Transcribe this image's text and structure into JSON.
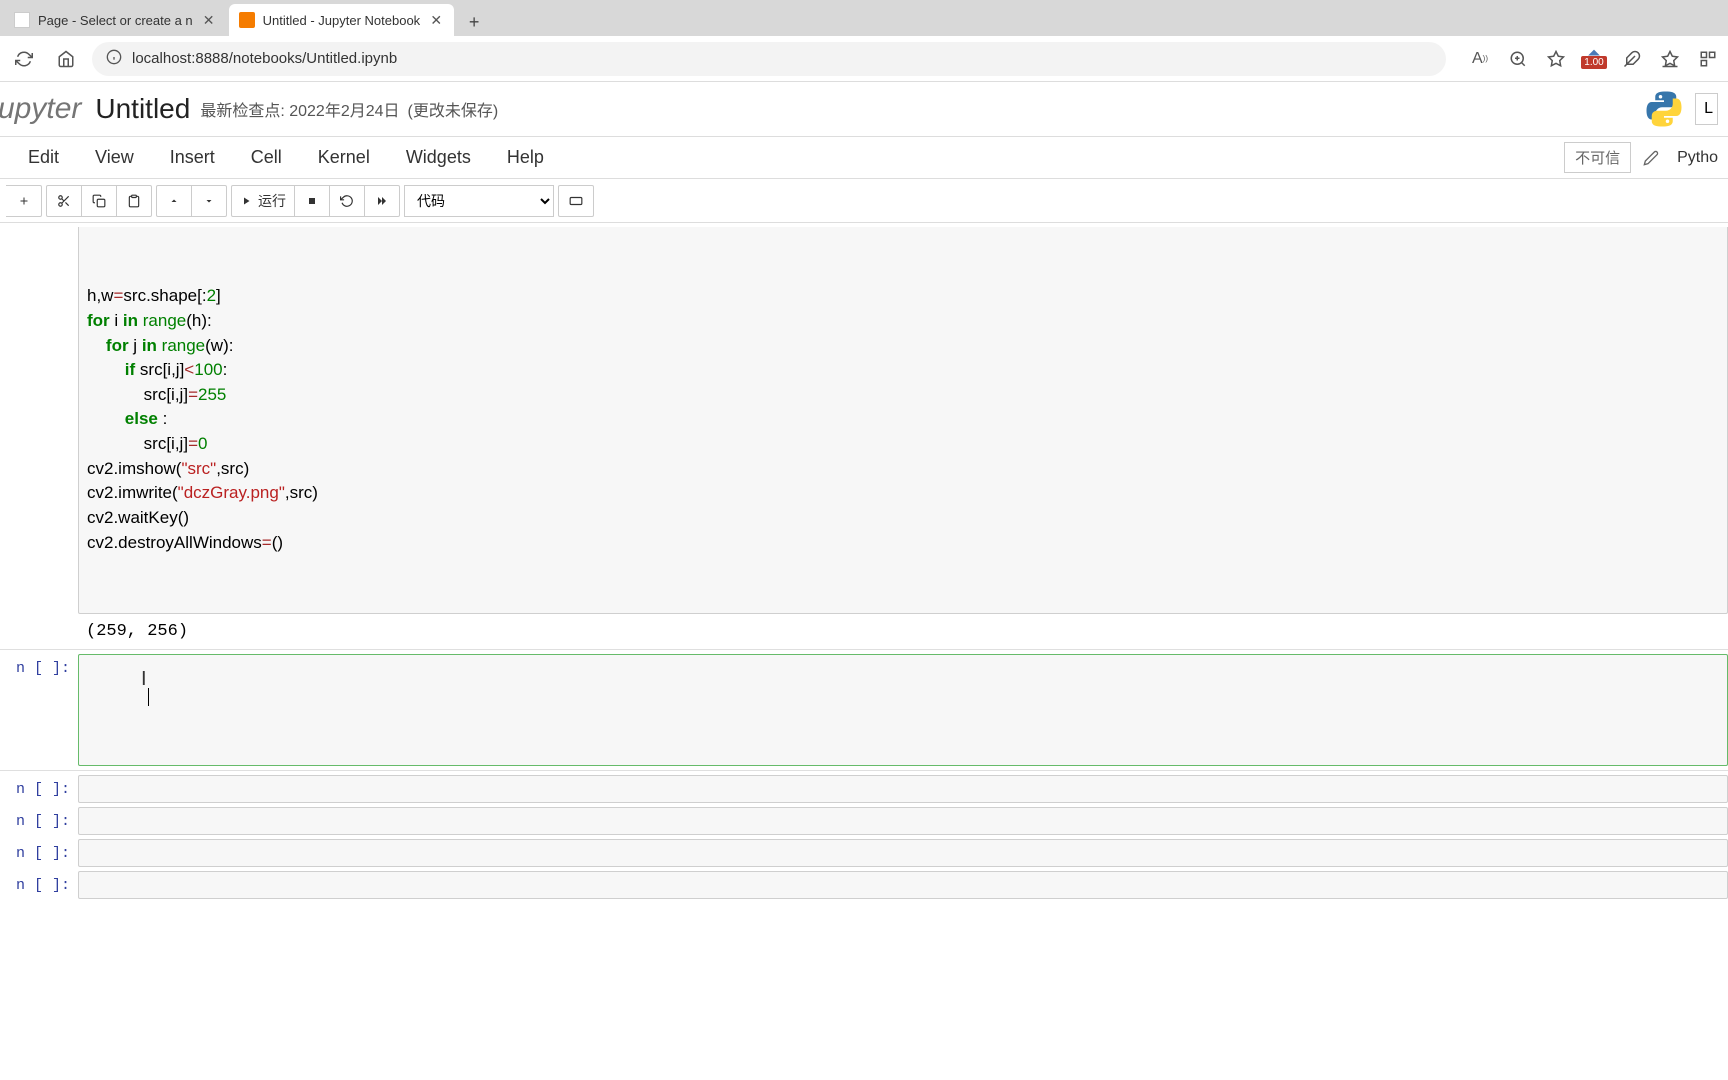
{
  "browser": {
    "tab1": {
      "title": "Page - Select or create a n",
      "favicon": "page"
    },
    "tab2": {
      "title": "Untitled - Jupyter Notebook",
      "favicon": "jupyter"
    },
    "url": "localhost:8888/notebooks/Untitled.ipynb",
    "scale_badge": "1.00"
  },
  "header": {
    "logo": "upyter",
    "title": "Untitled",
    "checkpoint_label": "最新检查点:",
    "checkpoint_date": "2022年2月24日",
    "unsaved": "(更改未保存)"
  },
  "menu": {
    "edit": "Edit",
    "view": "View",
    "insert": "Insert",
    "cell": "Cell",
    "kernel": "Kernel",
    "widgets": "Widgets",
    "help": "Help",
    "trusted": "不可信",
    "kernel_name": "Pytho"
  },
  "toolbar": {
    "run_label": "运行",
    "cell_type": "代码"
  },
  "cells": {
    "code_lines": [
      {
        "text": "h,w=src.shape[:2]",
        "html": "h,w<span class='op'>=</span>src.shape[:<span class='num'>2</span>]"
      },
      {
        "text": "for i in range(h):",
        "html": "<span class='kw'>for</span> i <span class='kw'>in</span> <span class='bn'>range</span>(h):"
      },
      {
        "text": "    for j in range(w):",
        "html": "    <span class='kw'>for</span> j <span class='kw'>in</span> <span class='bn'>range</span>(w):"
      },
      {
        "text": "        if src[i,j]<100:",
        "html": "        <span class='kw'>if</span> src[i,j]<span class='op'>&lt;</span><span class='num'>100</span>:"
      },
      {
        "text": "            src[i,j]=255",
        "html": "            src[i,j]<span class='op'>=</span><span class='num'>255</span>"
      },
      {
        "text": "        else :",
        "html": "        <span class='kw'>else</span> :"
      },
      {
        "text": "            src[i,j]=0",
        "html": "            src[i,j]<span class='op'>=</span><span class='num'>0</span>"
      },
      {
        "text": "cv2.imshow(\"src\",src)",
        "html": "cv2.imshow(<span class='str'>\"src\"</span>,src)"
      },
      {
        "text": "cv2.imwrite(\"dczGray.png\",src)",
        "html": "cv2.imwrite(<span class='str'>\"dczGray.png\"</span>,src)"
      },
      {
        "text": "cv2.waitKey()",
        "html": "cv2.waitKey()"
      },
      {
        "text": "cv2.destroyAllWindows=()",
        "html": "cv2.destroyAllWindows<span class='op'>=</span>()"
      }
    ],
    "output": "(259, 256)",
    "empty_prompt": "n [ ]:"
  }
}
